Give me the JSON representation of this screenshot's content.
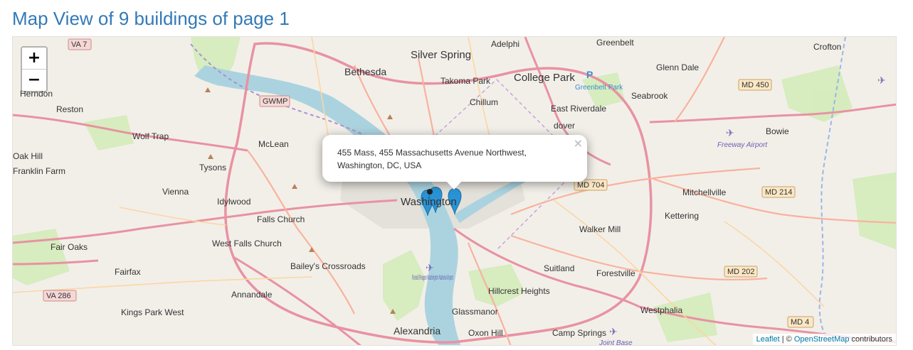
{
  "page": {
    "title": "Map View of 9 buildings of page 1"
  },
  "zoom": {
    "in_label": "+",
    "out_label": "−"
  },
  "popup": {
    "text": "455 Mass, 455 Massachusetts Avenue Northwest, Washington, DC, USA",
    "close": "×"
  },
  "attribution": {
    "leaflet": "Leaflet",
    "sep": " | © ",
    "osm": "OpenStreetMap",
    "suffix": " contributors"
  },
  "places": {
    "silver_spring": "Silver Spring",
    "bethesda": "Bethesda",
    "college_park": "College Park",
    "takoma_park": "Takoma Park",
    "chillum": "Chillum",
    "adelphi": "Adelphi",
    "greenbelt": "Greenbelt",
    "glenn_dale": "Glenn Dale",
    "crofton": "Crofton",
    "seabrook": "Seabrook",
    "east_riverdale": "East Riverdale",
    "greenbelt_park": "Greenbelt Park",
    "bowie": "Bowie",
    "freeway_airport": "Freeway Airport",
    "mitchellville": "Mitchellville",
    "kettering": "Kettering",
    "walker_mill": "Walker Mill",
    "washington": "Washington",
    "reston": "Reston",
    "herndon": "Herndon",
    "wolf_trap": "Wolf Trap",
    "mclean": "McLean",
    "tysons": "Tysons",
    "oak_hill": "Oak Hill",
    "franklin_farm": "Franklin Farm",
    "vienna": "Vienna",
    "idylwood": "Idylwood",
    "falls_church": "Falls Church",
    "west_falls_church": "West Falls Church",
    "fair_oaks": "Fair Oaks",
    "fairfax": "Fairfax",
    "baileys_crossroads": "Bailey's Crossroads",
    "annandale": "Annandale",
    "kings_park_west": "Kings Park West",
    "alexandria": "Alexandria",
    "oxon_hill": "Oxon Hill",
    "glassmanor": "Glassmanor",
    "hillcrest_heights": "Hillcrest Heights",
    "suitland": "Suitland",
    "forestville": "Forestville",
    "westphalia": "Westphalia",
    "camp_springs": "Camp Springs",
    "joint_base": "Joint Base",
    "reagan_airport": "Ronald Reagan Washington National Airport",
    "landover": "dover"
  },
  "shields": {
    "va7": "VA 7",
    "gwmp": "GWMP",
    "md450": "MD 450",
    "md704": "MD 704",
    "md214": "MD 214",
    "md202": "MD 202",
    "va286": "VA 286",
    "md4": "MD 4"
  },
  "colors": {
    "title": "#337ab7",
    "motorway": "#e892a2",
    "trunk": "#f9b29c",
    "primary": "#fcd6a4",
    "water": "#aad3df",
    "park": "#cdebb0",
    "marker": "#2a93d5"
  }
}
